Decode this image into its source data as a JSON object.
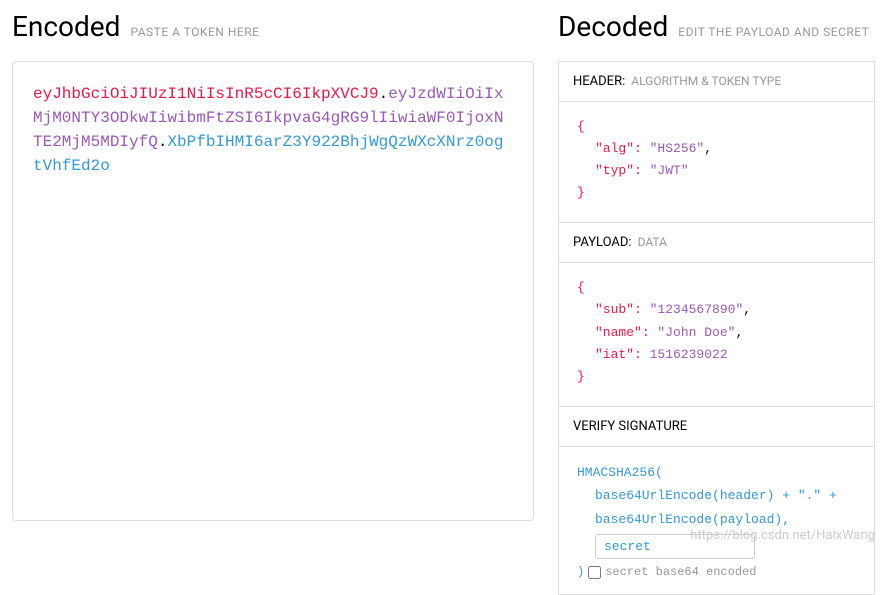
{
  "encoded": {
    "title": "Encoded",
    "subtitle": "PASTE A TOKEN HERE",
    "token_header": "eyJhbGciOiJIUzI1NiIsInR5cCI6IkpXVCJ9",
    "token_payload": "eyJzdWIiOiIxMjM0NTY3ODkwIiwibmFtZSI6IkpvaG4gRG9lIiwiaWF0IjoxNTE2MjM5MDIyfQ",
    "token_signature": "XbPfbIHMI6arZ3Y922BhjWgQzWXcXNrz0ogtVhfEd2o"
  },
  "decoded": {
    "title": "Decoded",
    "subtitle": "EDIT THE PAYLOAD AND SECRET",
    "header_section": {
      "label": "HEADER:",
      "sublabel": "ALGORITHM & TOKEN TYPE",
      "alg_key": "\"alg\"",
      "alg_val": "\"HS256\"",
      "typ_key": "\"typ\"",
      "typ_val": "\"JWT\""
    },
    "payload_section": {
      "label": "PAYLOAD:",
      "sublabel": "DATA",
      "sub_key": "\"sub\"",
      "sub_val": "\"1234567890\"",
      "name_key": "\"name\"",
      "name_val": "\"John Doe\"",
      "iat_key": "\"iat\"",
      "iat_val": "1516239022"
    },
    "signature_section": {
      "label": "VERIFY SIGNATURE",
      "line1": "HMACSHA256(",
      "line2": "base64UrlEncode(header) + \".\" +",
      "line3": "base64UrlEncode(payload),",
      "secret_value": "secret",
      "close": ")",
      "checkbox_label": "secret base64 encoded"
    }
  },
  "watermark": "https://blog.csdn.net/HaixWang"
}
